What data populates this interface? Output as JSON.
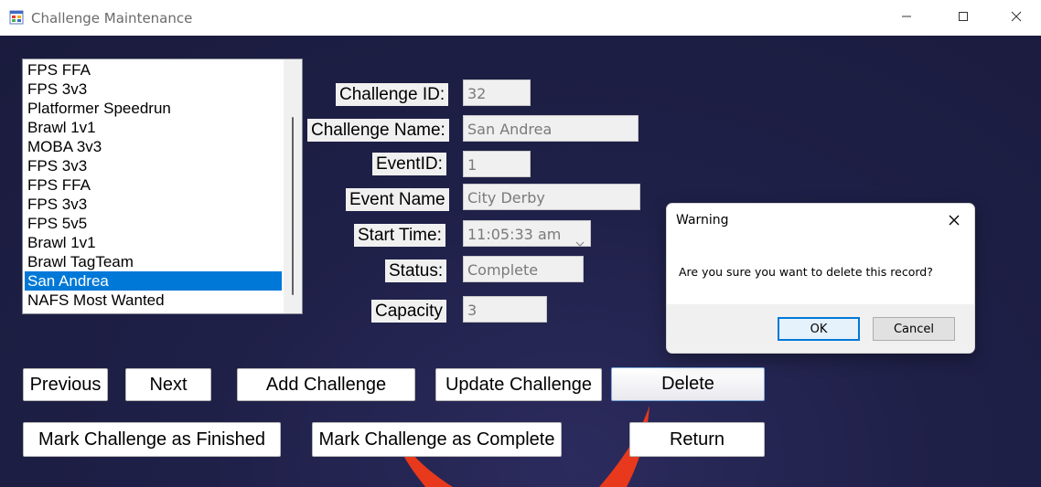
{
  "window": {
    "title": "Challenge Maintenance",
    "icon": "app-form-icon",
    "controls": [
      "minimize-icon",
      "maximize-icon",
      "close-icon"
    ]
  },
  "challenge_list": {
    "items": [
      "FPS FFA",
      "FPS 3v3",
      "Platformer Speedrun",
      "Brawl 1v1",
      "MOBA 3v3",
      "FPS 3v3",
      "FPS FFA",
      "FPS 3v3",
      "FPS 5v5",
      "Brawl 1v1",
      "Brawl TagTeam",
      "San Andrea",
      "NAFS Most Wanted"
    ],
    "selected_index": 11
  },
  "form": {
    "challenge_id": {
      "label": "Challenge ID:",
      "value": "32"
    },
    "challenge_name": {
      "label": "Challenge Name:",
      "value": "San Andrea"
    },
    "event_id": {
      "label": "EventID:",
      "value": "1"
    },
    "event_name": {
      "label": "Event Name",
      "value": "City Derby"
    },
    "start_time": {
      "label": "Start Time:",
      "value": "11:05:33 am"
    },
    "status": {
      "label": "Status:",
      "value": "Complete"
    },
    "capacity": {
      "label": "Capacity",
      "value": "3"
    }
  },
  "buttons": {
    "previous": "Previous",
    "next": "Next",
    "add": "Add Challenge",
    "update": "Update Challenge",
    "delete": "Delete",
    "mark_finished": "Mark Challenge as Finished",
    "mark_complete": "Mark Challenge as Complete",
    "return": "Return"
  },
  "dialog": {
    "title": "Warning",
    "message": "Are you sure you want to delete this record?",
    "ok": "OK",
    "cancel": "Cancel"
  },
  "colors": {
    "background": "#1f2048",
    "selection": "#0078d7",
    "accent_flame": "#e8391d"
  }
}
